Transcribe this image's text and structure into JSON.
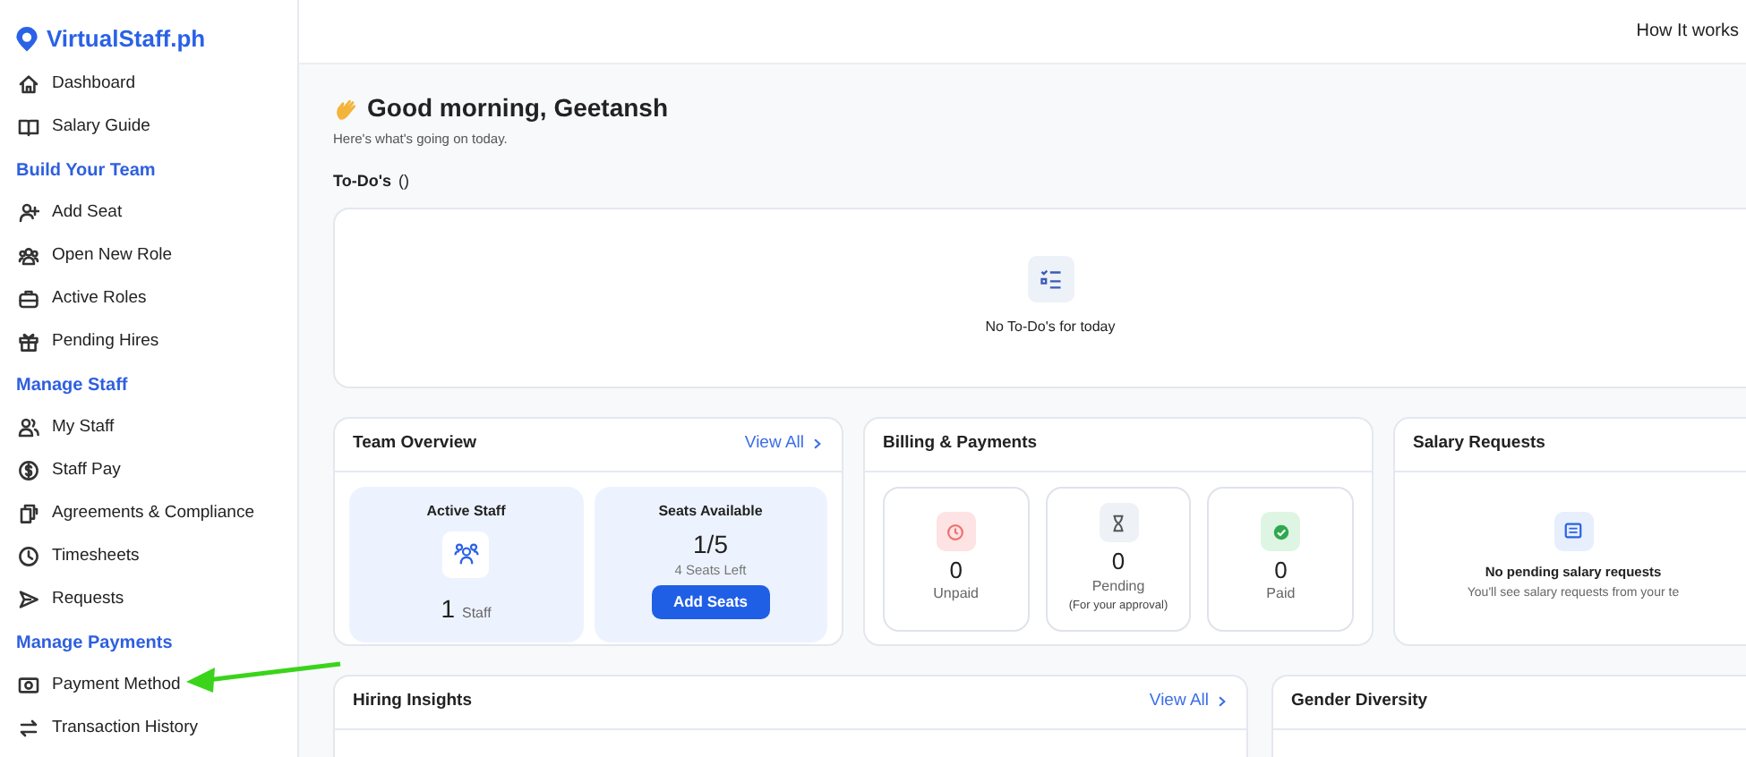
{
  "brand": "VirtualStaff.ph",
  "sidebar": {
    "sections": [
      {
        "items": [
          {
            "label": "Dashboard",
            "selected": false
          },
          {
            "label": "Salary Guide",
            "selected": false
          }
        ]
      },
      {
        "heading": "Build Your Team",
        "items": [
          {
            "label": "Add Seat",
            "selected": false
          },
          {
            "label": "Open New Role",
            "selected": false
          },
          {
            "label": "Active Roles",
            "selected": false
          },
          {
            "label": "Pending Hires",
            "selected": false
          }
        ]
      },
      {
        "heading": "Manage Staff",
        "items": [
          {
            "label": "My Staff",
            "selected": false
          },
          {
            "label": "Staff Pay",
            "selected": false
          },
          {
            "label": "Agreements & Compliance",
            "selected": false
          },
          {
            "label": "Timesheets",
            "selected": false
          },
          {
            "label": "Requests",
            "selected": false
          }
        ]
      },
      {
        "heading": "Manage Payments",
        "items": [
          {
            "label": "Payment Method",
            "selected": false
          },
          {
            "label": "Transaction History",
            "selected": false
          }
        ]
      }
    ]
  },
  "header": {
    "link": "How It works"
  },
  "greeting": {
    "title": "Good morning, Geetansh",
    "subtitle": "Here's what's going on today."
  },
  "todos": {
    "title": "To-Do's",
    "count": "()",
    "empty_text": "No To-Do's for today"
  },
  "team_overview": {
    "title": "Team Overview",
    "link": "View All",
    "active_staff": {
      "label": "Active Staff",
      "value": "1",
      "unit": "Staff"
    },
    "seats": {
      "label": "Seats Available",
      "value": "1/5",
      "note": "4 Seats Left",
      "button": "Add Seats"
    }
  },
  "billing": {
    "title": "Billing & Payments",
    "stats": [
      {
        "kind": "unpaid",
        "value": "0",
        "label": "Unpaid"
      },
      {
        "kind": "pending",
        "value": "0",
        "label": "Pending",
        "note": "(For your approval)"
      },
      {
        "kind": "paid",
        "value": "0",
        "label": "Paid"
      }
    ]
  },
  "salary_requests": {
    "title": "Salary Requests",
    "empty_title": "No pending salary requests",
    "empty_text": "You'll see salary requests from your te"
  },
  "hiring_insights": {
    "title": "Hiring Insights",
    "link": "View All"
  },
  "gender_diversity": {
    "title": "Gender Diversity"
  }
}
